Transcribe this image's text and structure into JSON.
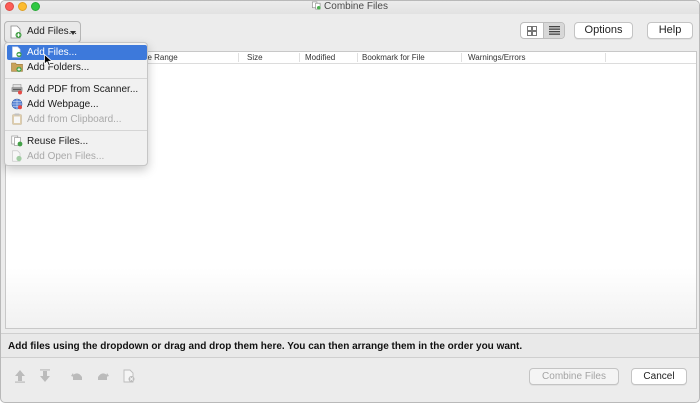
{
  "window": {
    "title": "Combine Files"
  },
  "toolbar": {
    "add_files_label": "Add Files...",
    "options_label": "Options",
    "help_label": "Help"
  },
  "table": {
    "columns": [
      "ge Range",
      "Size",
      "Modified",
      "Bookmark for File",
      "Warnings/Errors"
    ]
  },
  "menu": {
    "items": [
      {
        "label": "Add Files...",
        "icon": "add-file-icon",
        "enabled": true,
        "highlighted": true
      },
      {
        "label": "Add Folders...",
        "icon": "add-folder-icon",
        "enabled": true
      },
      {
        "label": "Add PDF from Scanner...",
        "icon": "scanner-icon",
        "enabled": true
      },
      {
        "label": "Add Webpage...",
        "icon": "globe-icon",
        "enabled": true
      },
      {
        "label": "Add from Clipboard...",
        "icon": "clipboard-icon",
        "enabled": false
      },
      {
        "label": "Reuse Files...",
        "icon": "reuse-files-icon",
        "enabled": true
      },
      {
        "label": "Add Open Files...",
        "icon": "open-files-icon",
        "enabled": false
      }
    ]
  },
  "status": {
    "message": "Add files using the dropdown or drag and drop them here. You can then arrange them in the order you want."
  },
  "footer": {
    "combine_label": "Combine Files",
    "cancel_label": "Cancel"
  },
  "colors": {
    "menu_highlight": "#3d79db",
    "close": "#fc5d57",
    "minimize": "#fdbc2e",
    "maximize": "#30c842"
  }
}
